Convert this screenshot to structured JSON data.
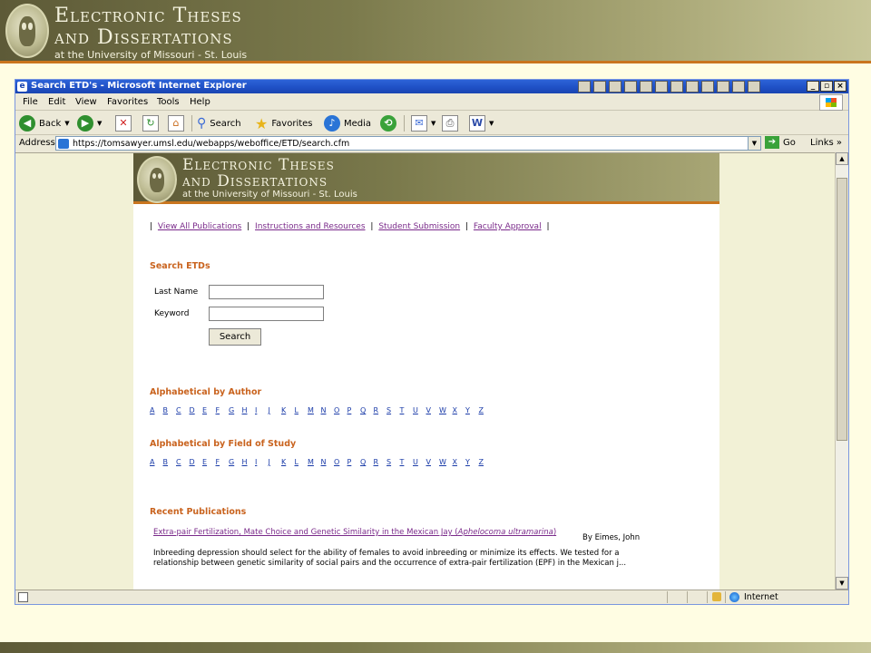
{
  "slide": {
    "title_line1": "Electronic Theses",
    "title_line2": "and Dissertations",
    "subtitle": "at the University of Missouri - St. Louis"
  },
  "window": {
    "title": "Search ETD's - Microsoft Internet Explorer",
    "min_symbol": "_",
    "max_symbol": "▫",
    "close_symbol": "×"
  },
  "menubar": [
    "File",
    "Edit",
    "View",
    "Favorites",
    "Tools",
    "Help"
  ],
  "toolbar": {
    "back": "Back",
    "search": "Search",
    "favorites": "Favorites",
    "media": "Media"
  },
  "address": {
    "label": "Address",
    "url": "https://tomsawyer.umsl.edu/webapps/weboffice/ETD/search.cfm",
    "go": "Go",
    "links": "Links"
  },
  "page": {
    "banner_line1": "Electronic Theses",
    "banner_line2": "and Dissertations",
    "banner_subtitle": "at the University of Missouri - St. Louis",
    "nav": [
      "View All Publications",
      "Instructions and Resources",
      "Student Submission",
      "Faculty Approval"
    ],
    "nav_separator": "|",
    "search_heading": "Search ETDs",
    "last_name_label": "Last Name",
    "keyword_label": "Keyword",
    "last_name_value": "",
    "keyword_value": "",
    "search_button": "Search",
    "author_heading": "Alphabetical by Author",
    "field_heading": "Alphabetical by Field of Study",
    "letters": [
      "A",
      "B",
      "C",
      "D",
      "E",
      "F",
      "G",
      "H",
      "I",
      "J",
      "K",
      "L",
      "M",
      "N",
      "O",
      "P",
      "Q",
      "R",
      "S",
      "T",
      "U",
      "V",
      "W",
      "X",
      "Y",
      "Z"
    ],
    "recent_heading": "Recent Publications",
    "publication": {
      "title": "Extra-pair Fertilization, Mate Choice and Genetic Similarity in the Mexican Jay (",
      "species": "Aphelocoma ultramarina",
      "title_end": ")",
      "author": "By Eimes, John",
      "abstract": "Inbreeding depression should select for the ability of females to avoid inbreeding or minimize its effects. We tested for a relationship between genetic similarity of social pairs and the occurrence of extra-pair fertilization (EPF) in the Mexican j..."
    }
  },
  "status": {
    "zone": "Internet"
  },
  "colors": {
    "heading": "#c9631e",
    "link": "#1a3ba8",
    "visited_link": "#7a2a8a",
    "banner": "#7b7a4c",
    "accent_bar": "#c9751e"
  }
}
